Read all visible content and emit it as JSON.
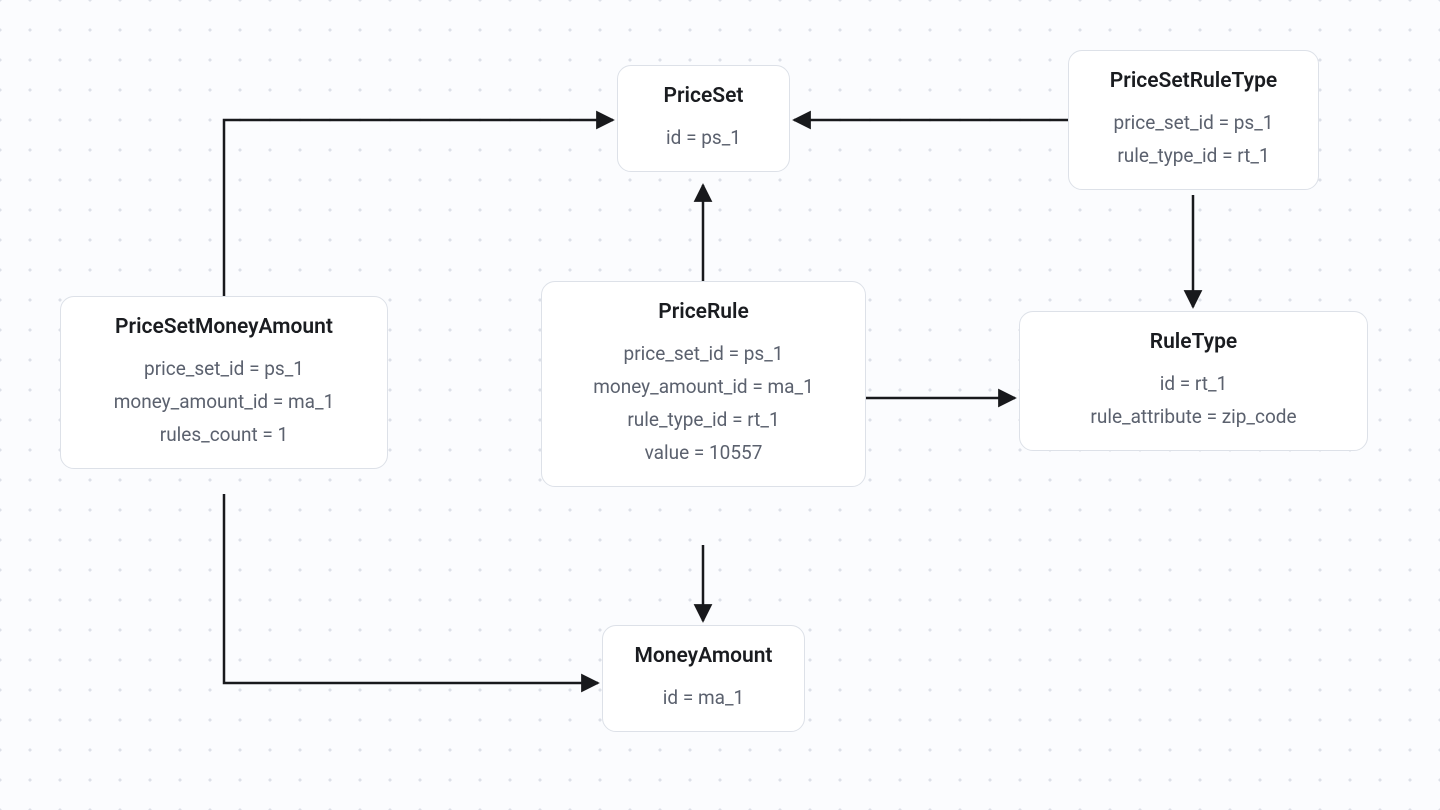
{
  "nodes": {
    "priceSet": {
      "title": "PriceSet",
      "fields": [
        "id = ps_1"
      ]
    },
    "priceSetRuleType": {
      "title": "PriceSetRuleType",
      "fields": [
        "price_set_id = ps_1",
        "rule_type_id = rt_1"
      ]
    },
    "priceSetMoneyAmount": {
      "title": "PriceSetMoneyAmount",
      "fields": [
        "price_set_id = ps_1",
        "money_amount_id = ma_1",
        "rules_count = 1"
      ]
    },
    "priceRule": {
      "title": "PriceRule",
      "fields": [
        "price_set_id = ps_1",
        "money_amount_id = ma_1",
        "rule_type_id = rt_1",
        "value = 10557"
      ]
    },
    "ruleType": {
      "title": "RuleType",
      "fields": [
        "id = rt_1",
        "rule_attribute = zip_code"
      ]
    },
    "moneyAmount": {
      "title": "MoneyAmount",
      "fields": [
        "id = ma_1"
      ]
    }
  },
  "edges": [
    {
      "from": "priceSetMoneyAmount",
      "to": "priceSet"
    },
    {
      "from": "priceSetMoneyAmount",
      "to": "moneyAmount"
    },
    {
      "from": "priceRule",
      "to": "priceSet"
    },
    {
      "from": "priceRule",
      "to": "moneyAmount"
    },
    {
      "from": "priceRule",
      "to": "ruleType"
    },
    {
      "from": "priceSetRuleType",
      "to": "priceSet"
    },
    {
      "from": "priceSetRuleType",
      "to": "ruleType"
    }
  ]
}
